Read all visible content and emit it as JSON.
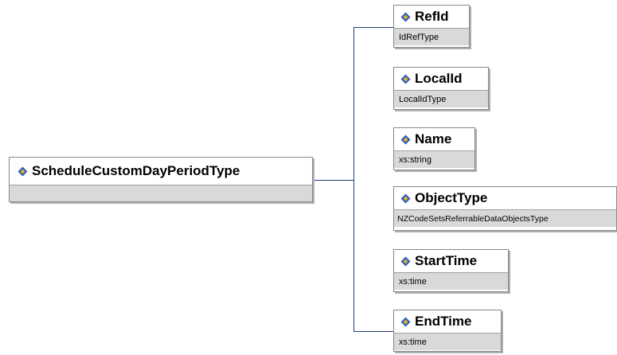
{
  "root": {
    "name": "ScheduleCustomDayPeriodType",
    "icon": "element-diamond-icon"
  },
  "children": [
    {
      "name": "RefId",
      "type": "IdRefType",
      "icon": "element-diamond-icon"
    },
    {
      "name": "LocalId",
      "type": "LocalIdType",
      "icon": "element-diamond-icon"
    },
    {
      "name": "Name",
      "type": "xs:string",
      "icon": "element-diamond-icon"
    },
    {
      "name": "ObjectType",
      "type": "NZCodeSetsReferrableDataObjectsType",
      "icon": "element-diamond-icon"
    },
    {
      "name": "StartTime",
      "type": "xs:time",
      "icon": "element-diamond-icon"
    },
    {
      "name": "EndTime",
      "type": "xs:time",
      "icon": "element-diamond-icon"
    }
  ],
  "colors": {
    "connector": "#1f3f78",
    "icon_blue": "#2b5fb8",
    "icon_gold": "#e8b02a",
    "sub_bg": "#d9d9d9"
  }
}
